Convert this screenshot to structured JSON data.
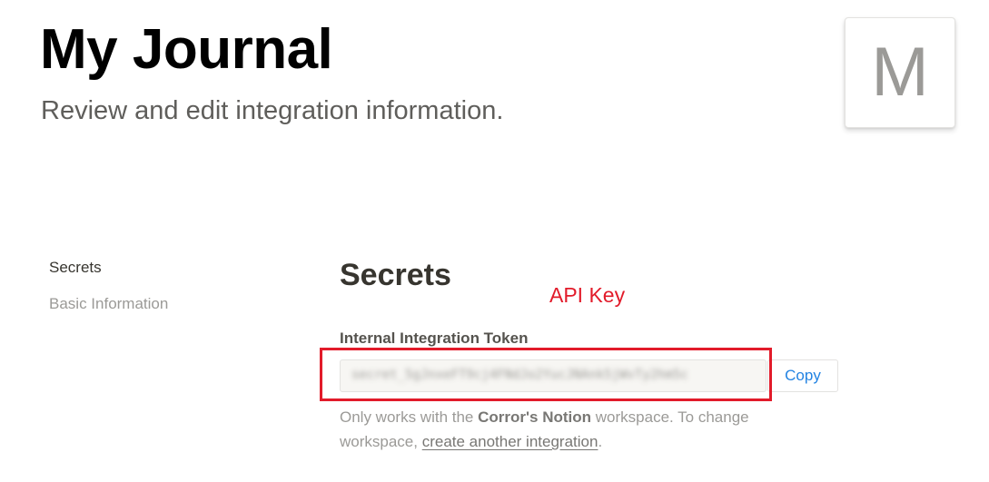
{
  "header": {
    "title": "My Journal",
    "subtitle": "Review and edit integration information.",
    "avatar_letter": "M"
  },
  "sidebar": {
    "items": [
      {
        "label": "Secrets",
        "active": true
      },
      {
        "label": "Basic Information",
        "active": false
      }
    ]
  },
  "secrets": {
    "title": "Secrets",
    "token_label": "Internal Integration Token",
    "token_value": "secret_5gJnxeFT9cj4FNdJo2YucJNAnk5jWvTy2hm5c",
    "copy_label": "Copy",
    "help": {
      "prefix": "Only works with the ",
      "workspace": "Corror's Notion",
      "middle": " workspace. To change workspace, ",
      "link": "create another integration",
      "suffix": "."
    }
  },
  "annotation": {
    "label": "API Key",
    "color": "#e21b2a"
  },
  "colors": {
    "accent": "#2383e2",
    "text": "#37352f",
    "muted": "#9b9a97"
  }
}
